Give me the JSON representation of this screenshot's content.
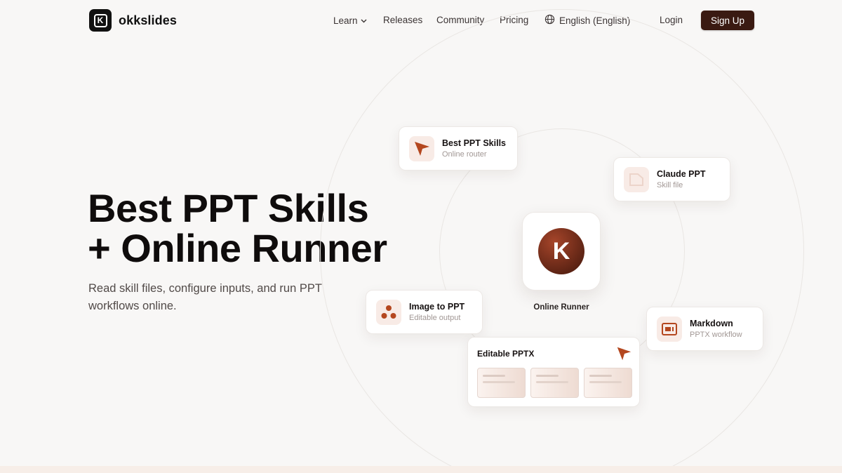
{
  "brand": {
    "logo_letter": "K",
    "name": "okkslides"
  },
  "nav": {
    "learn": "Learn",
    "releases": "Releases",
    "community": "Community",
    "pricing": "Pricing",
    "language": "English (English)",
    "login": "Login",
    "signup": "Sign Up"
  },
  "hero": {
    "title_line1": "Best PPT Skills",
    "title_line2": "+ Online Runner",
    "subtitle": "Read skill files, configure inputs, and run PPT workflows online."
  },
  "illustration": {
    "center": {
      "logo_letter": "K",
      "label": "Online Runner"
    },
    "cards": {
      "best_ppt": {
        "title": "Best PPT Skills",
        "subtitle": "Online router",
        "icon": "cursor-arrow-icon"
      },
      "claude_ppt": {
        "title": "Claude PPT",
        "subtitle": "Skill file",
        "icon": "file-icon"
      },
      "image_to_ppt": {
        "title": "Image to PPT",
        "subtitle": "Editable output",
        "icon": "dots-cluster-icon"
      },
      "markdown": {
        "title": "Markdown",
        "subtitle": "PPTX workflow",
        "icon": "slide-layout-icon"
      },
      "editable_pptx": {
        "title": "Editable PPTX",
        "icon": "cursor-arrow-icon",
        "thumbnail_count": 3
      }
    }
  },
  "colors": {
    "accent": "#b4471f",
    "signup_bg": "#3a1a12",
    "page_bg": "#f8f7f6",
    "icon_bg": "#f8ebe6"
  }
}
